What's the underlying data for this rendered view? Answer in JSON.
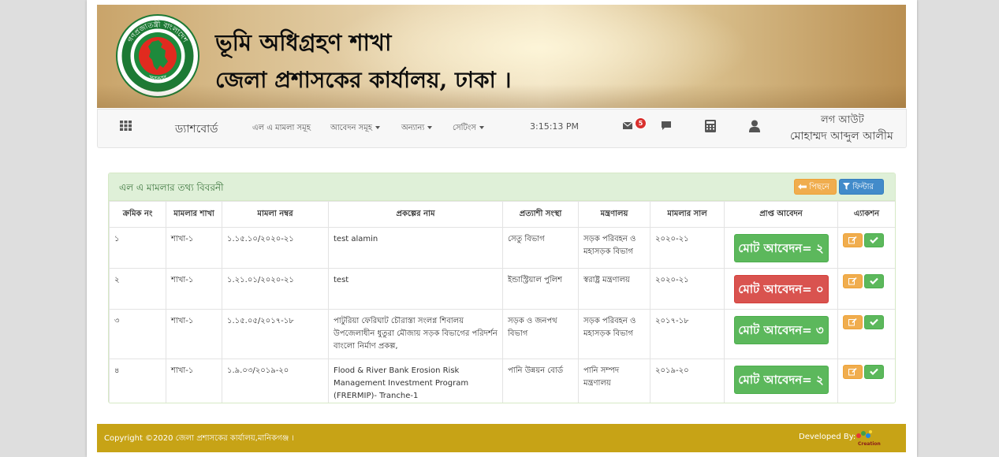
{
  "banner": {
    "title_line1": "ভূমি অধিগ্রহণ শাখা",
    "title_line2": "জেলা প্রশাসকের কার্যালয়, ঢাকা ।",
    "seal_top_text": "গণপ্রজাতন্ত্রী বাংলাদেশ",
    "seal_bottom_text": "সরকার"
  },
  "navbar": {
    "apps_icon": "grid-icon",
    "dashboard": "ড্যাশবোর্ড",
    "menu_cases": "এল এ মামলা সমূহ",
    "menu_applications": "আবেদন সমূহ",
    "menu_others": "অন্যান্য",
    "menu_settings": "সেটিংস",
    "time": "3:15:13 PM",
    "mail_badge": "5",
    "logout": "লগ আউট",
    "user_name": "মোহাম্মদ আব্দুল আলীম"
  },
  "panel": {
    "title": "এল এ মামলার তথ্য বিবরনী",
    "back_label": "পিছনে",
    "filter_label": "ফিল্টার",
    "columns": [
      "ক্রমিক নং",
      "মামলার শাখা",
      "মামলা নম্বর",
      "প্রকল্পের নাম",
      "প্রত্যাশী সংস্থা",
      "মন্ত্রণালয়",
      "মামলার সাল",
      "প্রাপ্ত আবেদন",
      "এ্যাকশন"
    ],
    "rows": [
      {
        "sl": "১",
        "branch": "শাখা-১",
        "case_no": "১.১৫.১০/২০২০-২১",
        "project": "test alamin",
        "agency": "সেতু বিভাগ",
        "ministry": "সড়ক পরিবহন ও মহাসড়ক বিভাগ",
        "year": "২০২০-২১",
        "total": "মোট আবেদন= ২",
        "status": "green"
      },
      {
        "sl": "২",
        "branch": "শাখা-১",
        "case_no": "১.২১.০১/২০২০-২১",
        "project": "test",
        "agency": "ইন্ডাস্ট্রিয়াল পুলিশ",
        "ministry": "স্বরাষ্ট্র মন্ত্রণালয়",
        "year": "২০২০-২১",
        "total": "মোট আবেদন= ০",
        "status": "red"
      },
      {
        "sl": "৩",
        "branch": "শাখা-১",
        "case_no": "১.১৫.০৫/২০১৭-১৮",
        "project": "পাটুরিয়া ফেরিঘাট চৌরাস্তা সংলগ্ন শিবালয় উপজেলাধীন ধুতুরা মৌজায় সড়ক বিভাগের পরিদর্শন বাংলো নির্মাণ প্রকল্প,",
        "agency": "সড়ক ও জনপথ বিভাগ",
        "ministry": "সড়ক পরিবহন ও মহাসড়ক বিভাগ",
        "year": "২০১৭-১৮",
        "total": "মোট আবেদন= ৩",
        "status": "green"
      },
      {
        "sl": "৪",
        "branch": "শাখা-১",
        "case_no": "১.৯.০৩/২০১৯-২০",
        "project": "Flood & River Bank Erosion Risk Management Investment Program (FRERMIP)- Tranche-1",
        "agency": "পানি উন্নয়ন বোর্ড",
        "ministry": "পানি সম্পদ মন্ত্রণালয়",
        "year": "২০১৯-২০",
        "total": "মোট আবেদন= ২",
        "status": "green"
      }
    ]
  },
  "footer": {
    "copyright": "Copyright ©2020 জেলা প্রশাসকের কার্যালয়,মানিকগঞ্জ ।",
    "developed_by": "Developed By:",
    "logo_text": "Creation"
  },
  "colors": {
    "accent_green": "#5cb85c",
    "accent_red": "#d9534f",
    "accent_orange": "#f0ad4e",
    "accent_blue": "#428bca",
    "footer_gold": "#c7a316",
    "panel_header": "#dff0d8"
  }
}
